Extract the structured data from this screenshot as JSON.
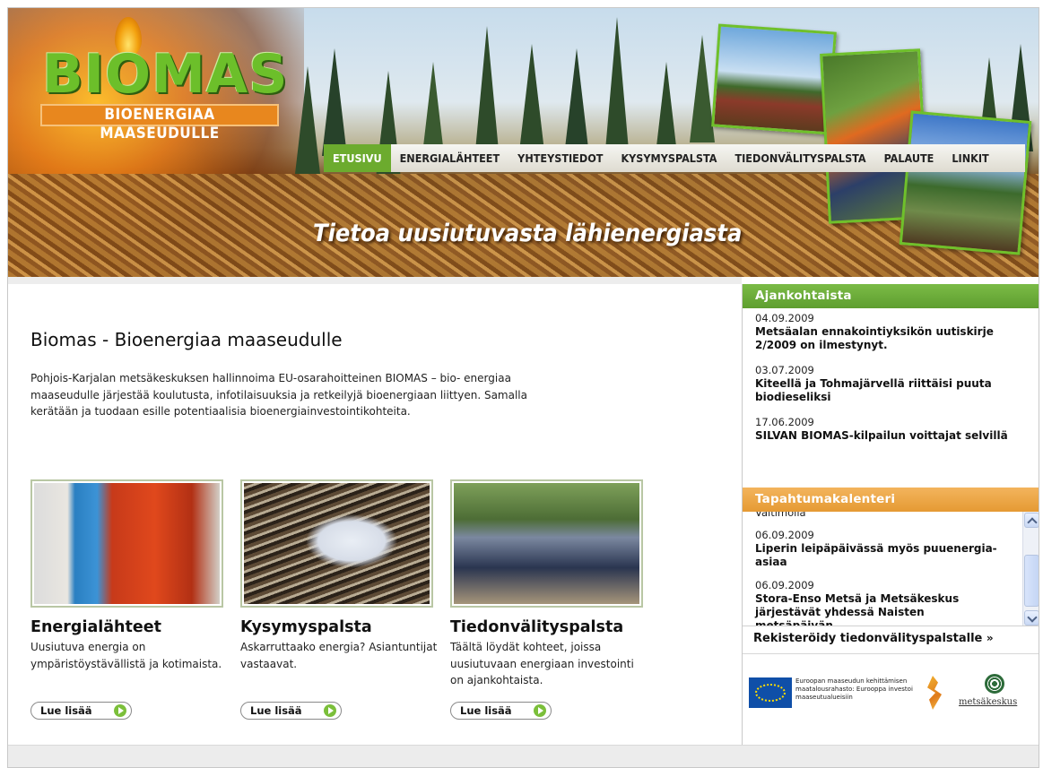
{
  "header": {
    "logo_text": "BIOMAS",
    "logo_subtitle": "BIOENERGIAA MAASEUDULLE",
    "tagline": "Tietoa uusiutuvasta lähienergiasta"
  },
  "nav": {
    "items": [
      {
        "label": "ETUSIVU",
        "active": true
      },
      {
        "label": "ENERGIALÄHTEET",
        "active": false
      },
      {
        "label": "YHTEYSTIEDOT",
        "active": false
      },
      {
        "label": "KYSYMYSPALSTA",
        "active": false
      },
      {
        "label": "TIEDONVÄLITYSPALSTA",
        "active": false
      },
      {
        "label": "PALAUTE",
        "active": false
      },
      {
        "label": "LINKIT",
        "active": false
      }
    ],
    "active_color": "#6cab2e"
  },
  "main": {
    "title": "Biomas - Bioenergiaa maaseudulle",
    "intro": "Pohjois-Karjalan metsäkeskuksen hallinnoima EU-osarahoitteinen BIOMAS – bio- energiaa maaseudulle järjestää koulutusta, infotilaisuuksia ja retkeilyjä bioenergiaan liittyen. Samalla kerätään ja tuodaan esille potentiaalisia bioenergiainvestointikohteita.",
    "cards": [
      {
        "title": "Energialähteet",
        "text": "Uusiutuva energia on ympäristöystävällistä ja kotimaista.",
        "button": "Lue lisää"
      },
      {
        "title": "Kysymyspalsta",
        "text": "Askarruttaako energia? Asiantuntijat vastaavat.",
        "button": "Lue lisää"
      },
      {
        "title": "Tiedonvälityspalsta",
        "text": "Täältä löydät kohteet, joissa uusiutuvaan energiaan investointi on ajankohtaista.",
        "button": "Lue lisää"
      }
    ]
  },
  "sidebar": {
    "news_heading": "Ajankohtaista",
    "news": [
      {
        "date": "04.09.2009",
        "title": "Metsäalan ennakointiyksikön uutiskirje 2/2009 on ilmestynyt."
      },
      {
        "date": "03.07.2009",
        "title": "Kiteellä ja Tohmajärvellä riittäisi puuta biodieseliksi"
      },
      {
        "date": "17.06.2009",
        "title": "SILVAN BIOMAS-kilpailun voittajat selvillä"
      }
    ],
    "events_heading": "Tapahtumakalenteri",
    "events_cutoff": "Valtimolla",
    "events": [
      {
        "date": "06.09.2009",
        "title": "Liperin leipäpäivässä myös puuenergia-asiaa"
      },
      {
        "date": "06.09.2009",
        "title": "Stora-Enso Metsä ja Metsäkeskus järjestävät yhdessä Naisten metsäpäivän"
      }
    ],
    "register_link": "Rekisteröidy tiedonvälityspalstalle",
    "register_arrow": "»",
    "eu_text": "Euroopan maaseudun kehittämisen maatalousrahasto: Eurooppa investoi maaseutualueisiin",
    "partner_logo_text": "metsäkeskus"
  }
}
